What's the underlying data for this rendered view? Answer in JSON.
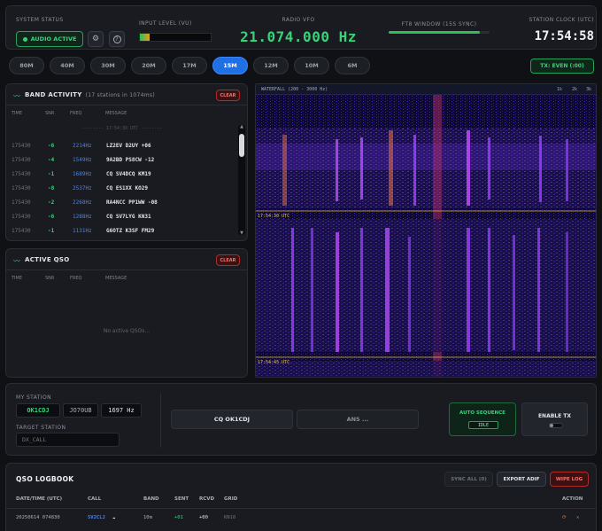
{
  "header": {
    "system_status_label": "SYSTEM STATUS",
    "audio_button": "AUDIO ACTIVE",
    "settings_icon": "gear-icon",
    "help_icon": "help-icon",
    "input_level_label": "INPUT LEVEL (VU)",
    "input_level": 0.14,
    "vfo_label": "RADIO VFO",
    "vfo_frequency": "21.074.000 Hz",
    "ft8_window_label": "FT8 WINDOW (15S SYNC)",
    "ft8_window_progress": 0.9,
    "clock_label": "STATION CLOCK (UTC)",
    "clock": "17:54:58"
  },
  "bands": {
    "items": [
      "80M",
      "40M",
      "30M",
      "20M",
      "17M",
      "15M",
      "12M",
      "10M",
      "6M"
    ],
    "active": "15M",
    "tx_badge": "TX: EVEN (:00)"
  },
  "activity": {
    "title": "BAND ACTIVITY",
    "subtitle": "(17 stations in 1074ms)",
    "clear": "CLEAR",
    "columns": [
      "TIME",
      "SNR",
      "FREQ",
      "MESSAGE"
    ],
    "separator": "-------- 17:54:30 UTC --------",
    "rows": [
      {
        "time": "175430",
        "snr": "-6",
        "freq": "2214Hz",
        "msg": "LZ2EV D2UY +06"
      },
      {
        "time": "175430",
        "snr": "-4",
        "freq": "1549Hz",
        "msg": "9A2BD PS8CW -12"
      },
      {
        "time": "175430",
        "snr": "-1",
        "freq": "1689Hz",
        "msg": "CQ SV4DCQ KM19"
      },
      {
        "time": "175430",
        "snr": "-8",
        "freq": "2537Hz",
        "msg": "CQ ES1XX KO29"
      },
      {
        "time": "175430",
        "snr": "-2",
        "freq": "2268Hz",
        "msg": "RA4NCC PP1WW -08"
      },
      {
        "time": "175430",
        "snr": "-6",
        "freq": "1288Hz",
        "msg": "CQ SV7LYG KN31"
      },
      {
        "time": "175430",
        "snr": "-1",
        "freq": "1131Hz",
        "msg": "G6OTZ K3SF FM29"
      }
    ]
  },
  "qso": {
    "title": "ACTIVE QSO",
    "clear": "CLEAR",
    "columns": [
      "TIME",
      "SNR",
      "FREQ",
      "MESSAGE"
    ],
    "empty": "No active QSOs..."
  },
  "waterfall": {
    "title": "WATERFALL (200 - 3000 Hz)",
    "ticks": [
      "1k",
      "2k",
      "3k"
    ],
    "time_markers": [
      "17:54:30 UTC",
      "17:54:45 UTC"
    ]
  },
  "station": {
    "my_station_label": "MY STATION",
    "callsign": "OK1CDJ",
    "locator": "JO70UB",
    "tx_freq": "1697 Hz",
    "target_label": "TARGET STATION",
    "target_placeholder": "DX_CALL",
    "cq_button": "CQ OK1CDJ",
    "ans_button": "ANS ...",
    "auto_sequence_label": "AUTO SEQUENCE",
    "auto_sequence_state": "IDLE",
    "enable_tx": "ENABLE TX"
  },
  "logbook": {
    "title": "QSO LOGBOOK",
    "sync_button": "SYNC ALL (0)",
    "export_button": "EXPORT ADIF",
    "wipe_button": "WIPE LOG",
    "columns": [
      "DATE/TIME (UTC)",
      "CALL",
      "BAND",
      "SENT",
      "RCVD",
      "GRID",
      "ACTION"
    ],
    "rows": [
      {
        "datetime": "20250614 074830",
        "call": "SV2CLJ",
        "band": "10m",
        "sent": "+01",
        "rcvd": "+00",
        "grid": "KN10"
      }
    ]
  },
  "colors": {
    "accent_green": "#37d27a",
    "accent_blue": "#1f6fe5",
    "accent_red": "#ff6b6b"
  }
}
